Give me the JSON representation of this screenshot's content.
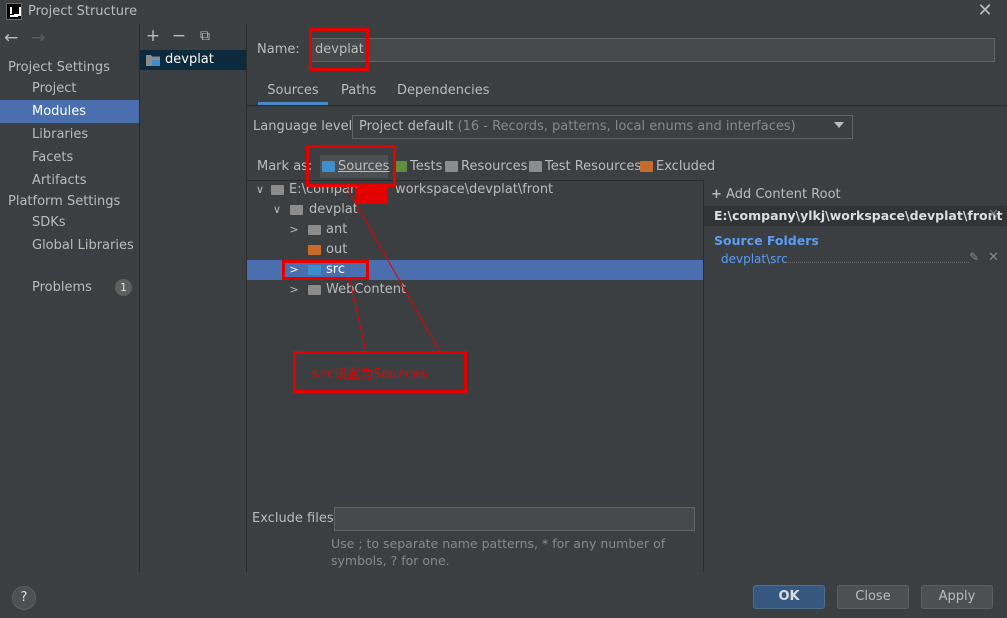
{
  "window": {
    "title": "Project Structure",
    "close_icon": "close-icon"
  },
  "sidebar": {
    "project_settings": "Project Settings",
    "project_items": [
      "Project",
      "Modules",
      "Libraries",
      "Facets",
      "Artifacts"
    ],
    "platform_settings": "Platform Settings",
    "platform_items": [
      "SDKs",
      "Global Libraries"
    ],
    "problems": "Problems",
    "problems_count": "1",
    "selected": "Modules"
  },
  "module_list": {
    "add": "+",
    "remove": "−",
    "copy": "⧉",
    "items": [
      "devplat"
    ]
  },
  "name": {
    "label": "Name:",
    "value": "devplat"
  },
  "tabs": [
    "Sources",
    "Paths",
    "Dependencies"
  ],
  "language_level": {
    "label": "Language level:",
    "value": "Project default",
    "hint": "(16 - Records, patterns, local enums and interfaces)"
  },
  "mark_as": {
    "label": "Mark as:",
    "buttons": [
      {
        "label": "Sources",
        "color": "#3d8fcf"
      },
      {
        "label": "Tests",
        "color": "#5f8f3e"
      },
      {
        "label": "Resources",
        "color": "#8c8c8c"
      },
      {
        "label": "Test Resources",
        "color": "#8c8c8c"
      },
      {
        "label": "Excluded",
        "color": "#c76b2b"
      }
    ]
  },
  "tree": {
    "root": "E:\\company\\ylkj\\workspace\\devplat\\front",
    "root_visible": "E:\\company",
    "root_tail": "workspace\\devplat\\front",
    "nodes": [
      {
        "label": "devplat",
        "expanded": true
      },
      {
        "label": "ant"
      },
      {
        "label": "out"
      },
      {
        "label": "src",
        "selected": true
      },
      {
        "label": "WebContent"
      }
    ]
  },
  "content_root": {
    "add": "Add Content Root",
    "path": "E:\\company\\ylkj\\workspace\\devplat\\front",
    "source_folders_heading": "Source Folders",
    "source_folder": "devplat\\src"
  },
  "exclude": {
    "label": "Exclude files:",
    "value": "",
    "hint": "Use ; to separate name patterns, * for any number of symbols, ? for one."
  },
  "footer": {
    "help": "?",
    "ok": "OK",
    "close": "Close",
    "apply": "Apply"
  },
  "annotation": {
    "text": "src设置为Sources",
    "color": "#e50000"
  }
}
